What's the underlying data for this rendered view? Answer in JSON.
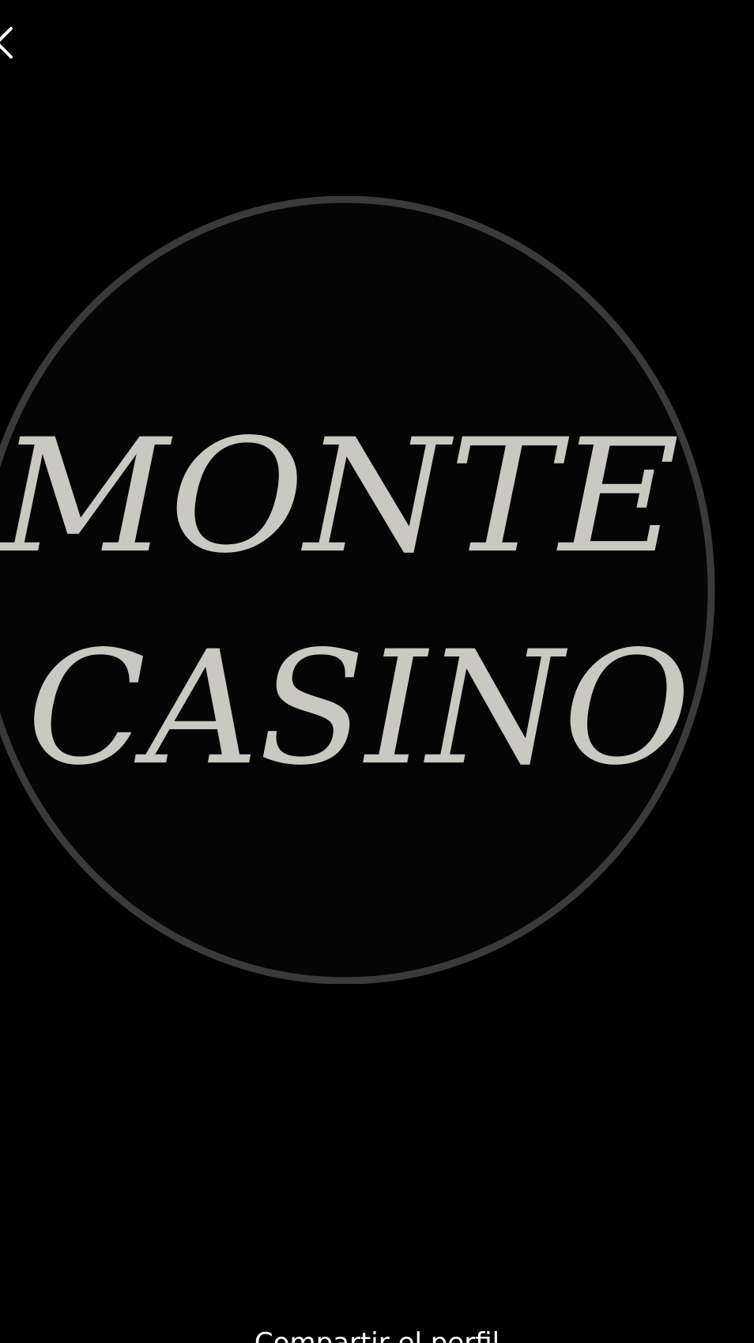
{
  "header": {
    "close_icon": "close-icon"
  },
  "logo": {
    "line1": "MONTE",
    "line2": "CASINO",
    "ring_color": "#3a3a3a",
    "text_color": "#c9c9c2",
    "fill_color": "#050505"
  },
  "footer": {
    "caption": "Compartir el perfil"
  }
}
